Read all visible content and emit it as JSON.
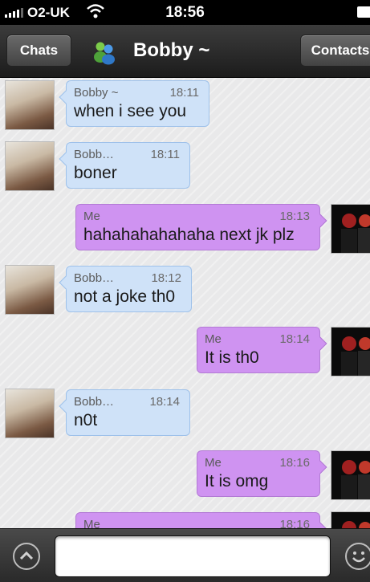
{
  "status_bar": {
    "carrier": "O2-UK",
    "time": "18:56"
  },
  "nav": {
    "back_label": "Chats",
    "title": "Bobby ~",
    "contacts_label": "Contacts"
  },
  "messages": [
    {
      "direction": "in",
      "sender": "Bobby ~",
      "time": "18:11",
      "text": "when i see you"
    },
    {
      "direction": "in",
      "sender": "Bobb…",
      "time": "18:11",
      "text": "boner"
    },
    {
      "direction": "out",
      "sender": "Me",
      "time": "18:13",
      "text": "hahahahahahaha next jk plz"
    },
    {
      "direction": "in",
      "sender": "Bobb…",
      "time": "18:12",
      "text": "not a joke th0"
    },
    {
      "direction": "out",
      "sender": "Me",
      "time": "18:14",
      "text": "It is th0"
    },
    {
      "direction": "in",
      "sender": "Bobb…",
      "time": "18:14",
      "text": "n0t"
    },
    {
      "direction": "out",
      "sender": "Me",
      "time": "18:16",
      "text": "It is omg"
    },
    {
      "direction": "out",
      "sender": "Me",
      "time": "18:16",
      "text": ""
    }
  ],
  "input": {
    "value": "",
    "placeholder": ""
  },
  "colors": {
    "incoming_bubble": "#cfe2f8",
    "outgoing_bubble": "#cf93f1",
    "nav_bar": "#2c2c2c"
  }
}
